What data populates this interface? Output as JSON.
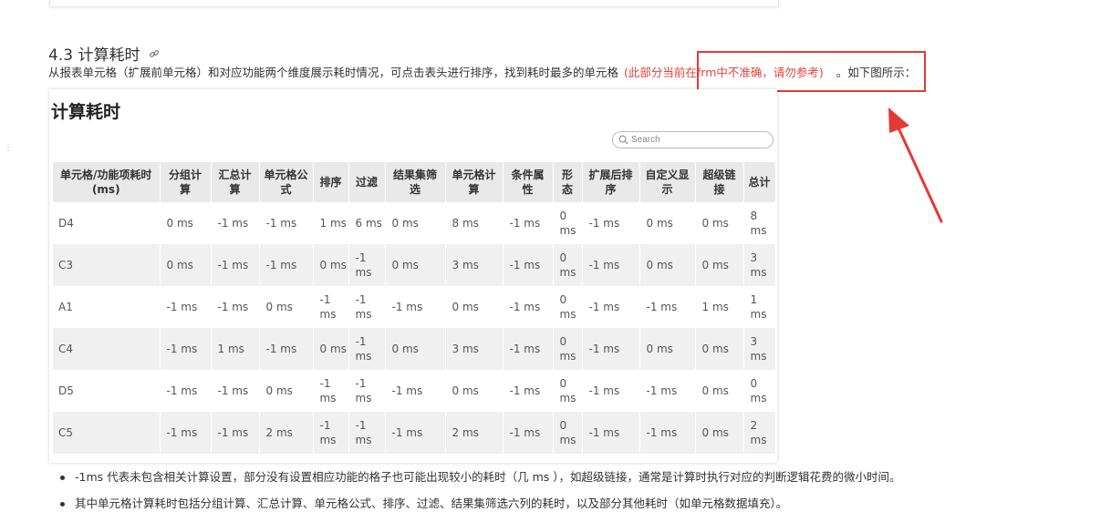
{
  "section": {
    "title": "4.3 计算耗时",
    "intro_text": "从报表单元格（扩展前单元格）和对应功能两个维度展示耗时情况，可点击表头进行排序，找到耗时最多的单元格",
    "highlight_text": "(此部分当前在frm中不准确，请勿参考)",
    "after_text": "。如下图所示："
  },
  "screenshot": {
    "title": "计算耗时",
    "search_placeholder": "Search",
    "columns": [
      "单元格/功能项耗时(ms)",
      "分组计算",
      "汇总计算",
      "单元格公式",
      "排序",
      "过滤",
      "结果集筛选",
      "单元格计算",
      "条件属性",
      "形态",
      "扩展后排序",
      "自定义显示",
      "超级链接",
      "总计"
    ],
    "rows": [
      [
        "D4",
        "0 ms",
        "-1 ms",
        "-1 ms",
        "1 ms",
        "6 ms",
        "0 ms",
        "8 ms",
        "-1 ms",
        "0 ms",
        "-1 ms",
        "0 ms",
        "0 ms",
        "8 ms"
      ],
      [
        "C3",
        "0 ms",
        "-1 ms",
        "-1 ms",
        "0 ms",
        "-1 ms",
        "0 ms",
        "3 ms",
        "-1 ms",
        "0 ms",
        "-1 ms",
        "0 ms",
        "0 ms",
        "3 ms"
      ],
      [
        "A1",
        "-1 ms",
        "-1 ms",
        "0 ms",
        "-1 ms",
        "-1 ms",
        "-1 ms",
        "0 ms",
        "-1 ms",
        "0 ms",
        "-1 ms",
        "-1 ms",
        "1 ms",
        "1 ms"
      ],
      [
        "C4",
        "-1 ms",
        "1 ms",
        "-1 ms",
        "0 ms",
        "-1 ms",
        "0 ms",
        "3 ms",
        "-1 ms",
        "0 ms",
        "-1 ms",
        "0 ms",
        "0 ms",
        "3 ms"
      ],
      [
        "D5",
        "-1 ms",
        "-1 ms",
        "0 ms",
        "-1 ms",
        "-1 ms",
        "-1 ms",
        "0 ms",
        "-1 ms",
        "0 ms",
        "-1 ms",
        "-1 ms",
        "0 ms",
        "0 ms"
      ],
      [
        "C5",
        "-1 ms",
        "-1 ms",
        "2 ms",
        "-1 ms",
        "-1 ms",
        "-1 ms",
        "2 ms",
        "-1 ms",
        "0 ms",
        "-1 ms",
        "-1 ms",
        "0 ms",
        "2 ms"
      ]
    ]
  },
  "notes": [
    "-1ms 代表未包含相关计算设置，部分没有设置相应功能的格子也可能出现较小的耗时（几 ms ），如超级链接，通常是计算时执行对应的判断逻辑花费的微小时间。",
    "其中单元格计算耗时包括分组计算、汇总计算、单元格公式、排序、过滤、结果集筛选六列的耗时，以及部分其他耗时（如单元格数据填充）。"
  ],
  "icons": {
    "link": "link-icon",
    "search": "search-icon",
    "arrow": "annotation-arrow"
  },
  "colors": {
    "highlight_red": "#e53935",
    "highlight_text": "#e0433b",
    "header_bg": "#e9e9e9",
    "alt_row_bg": "#f0f0f0"
  }
}
